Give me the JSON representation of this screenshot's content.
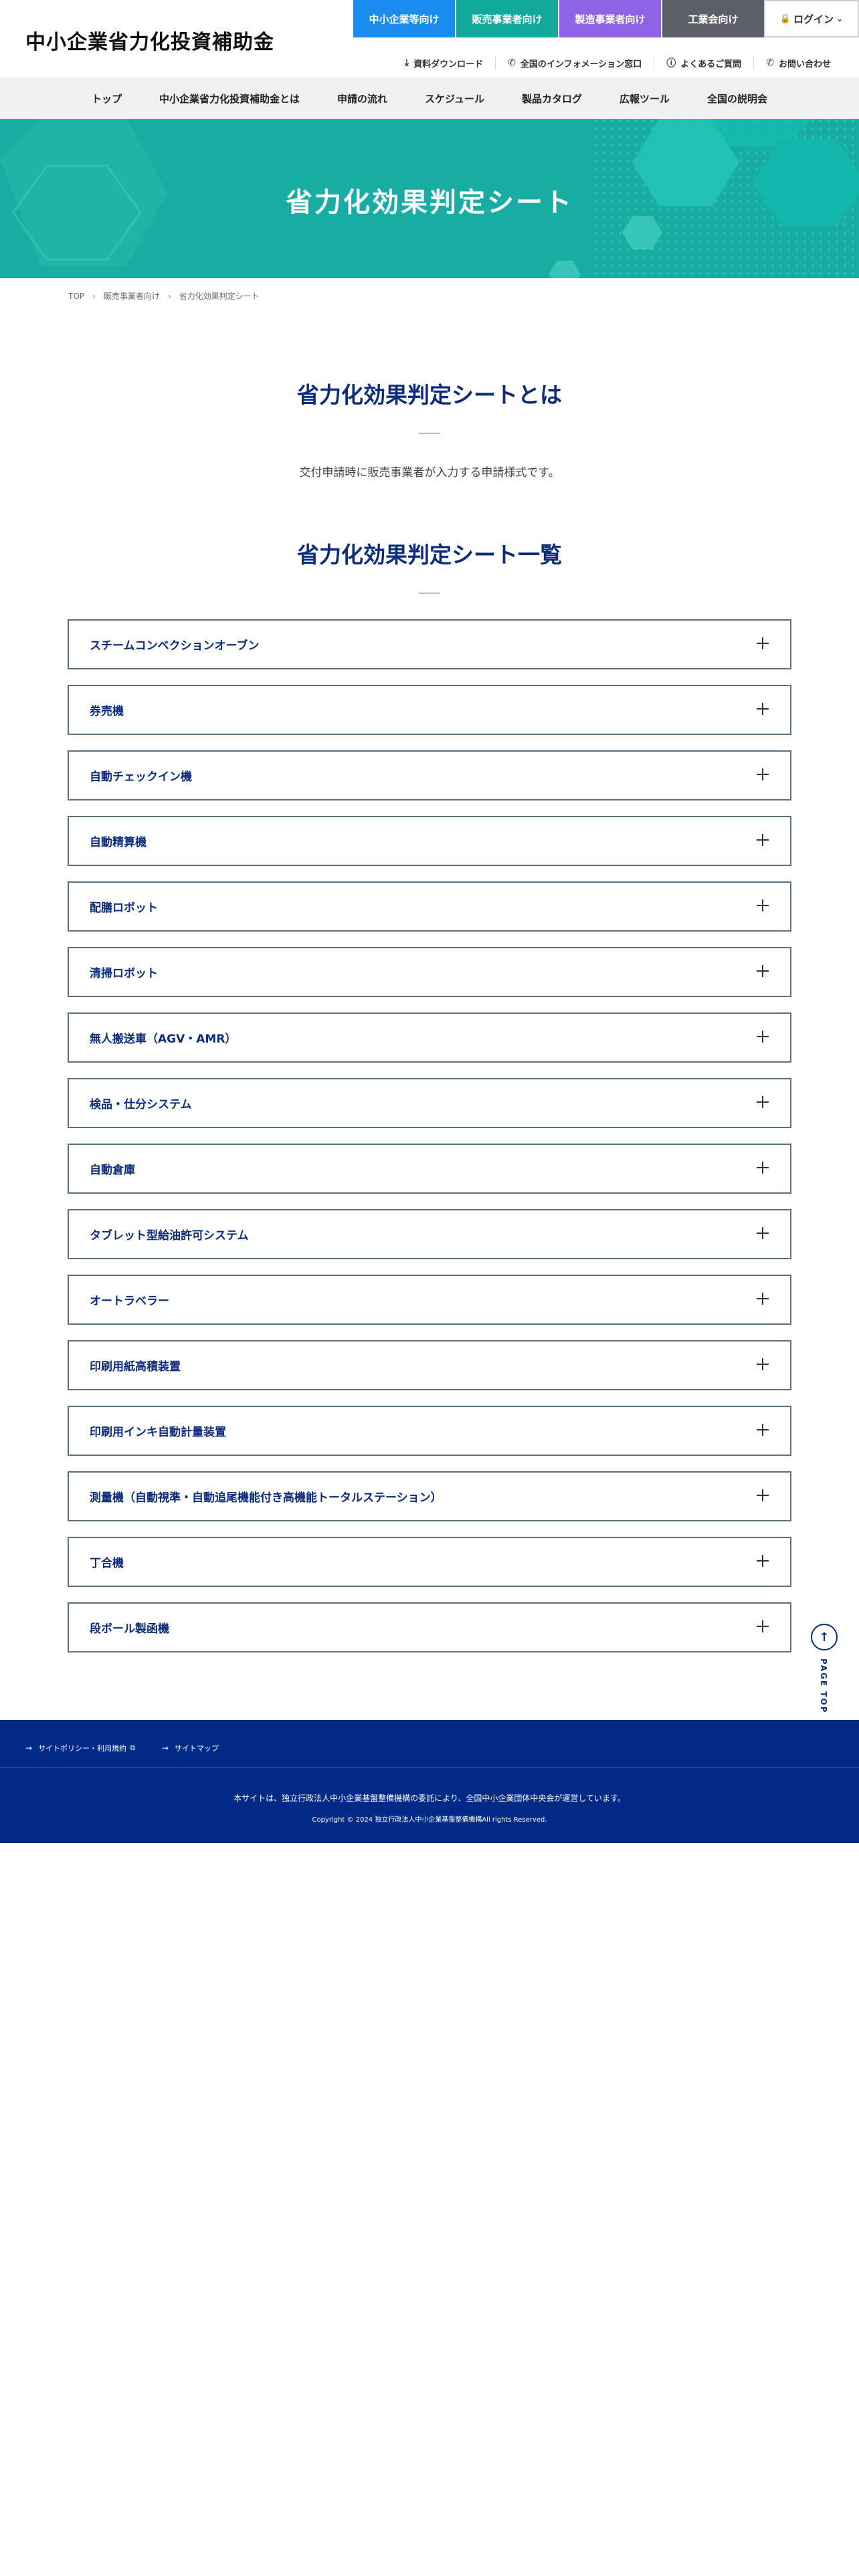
{
  "header": {
    "site_title": "中小企業省力化投資補助金",
    "audience_tabs": [
      {
        "label": "中小企業等向け",
        "color": "#1a8cf0"
      },
      {
        "label": "販売事業者向け",
        "color": "#10a99c"
      },
      {
        "label": "製造事業者向け",
        "color": "#8f63e6"
      },
      {
        "label": "工業会向け",
        "color": "#5d5f68"
      }
    ],
    "login_label": "ログイン",
    "utility_links": [
      {
        "label": "資料ダウンロード",
        "icon": "download-icon"
      },
      {
        "label": "全国のインフォメーション窓口",
        "icon": "phone-icon"
      },
      {
        "label": "よくあるご質問",
        "icon": "question-icon"
      },
      {
        "label": "お問い合わせ",
        "icon": "phone-icon"
      }
    ]
  },
  "global_nav": [
    "トップ",
    "中小企業省力化投資補助金とは",
    "申請の流れ",
    "スケジュール",
    "製品カタログ",
    "広報ツール",
    "全国の説明会"
  ],
  "hero": {
    "title": "省力化効果判定シート",
    "color": "#18ada2"
  },
  "breadcrumb": [
    "TOP",
    "販売事業者向け",
    "省力化効果判定シート"
  ],
  "about": {
    "title": "省力化効果判定シートとは",
    "lead": "交付申請時に販売事業者が入力する申請様式です。"
  },
  "list_section": {
    "title": "省力化効果判定シート一覧",
    "items": [
      "スチームコンベクションオーブン",
      "券売機",
      "自動チェックイン機",
      "自動精算機",
      "配膳ロボット",
      "清掃ロボット",
      "無人搬送車（AGV・AMR）",
      "検品・仕分システム",
      "自動倉庫",
      "タブレット型給油許可システム",
      "オートラベラー",
      "印刷用紙高積装置",
      "印刷用インキ自動計量装置",
      "測量機（自動視準・自動追尾機能付き高機能トータルステーション）",
      "丁合機",
      "段ボール製函機"
    ]
  },
  "page_top": {
    "label": "PAGE TOP"
  },
  "footer": {
    "links": [
      "サイトポリシー・利用規約",
      "サイトマップ"
    ],
    "note": "本サイトは、独立行政法人中小企業基盤整備機構の委託により、全国中小企業団体中央会が運営しています。",
    "copyright": "Copyright © 2024 独立行政法人中小企業基盤整備機構All rights Reserved.",
    "color": "#002a86"
  }
}
